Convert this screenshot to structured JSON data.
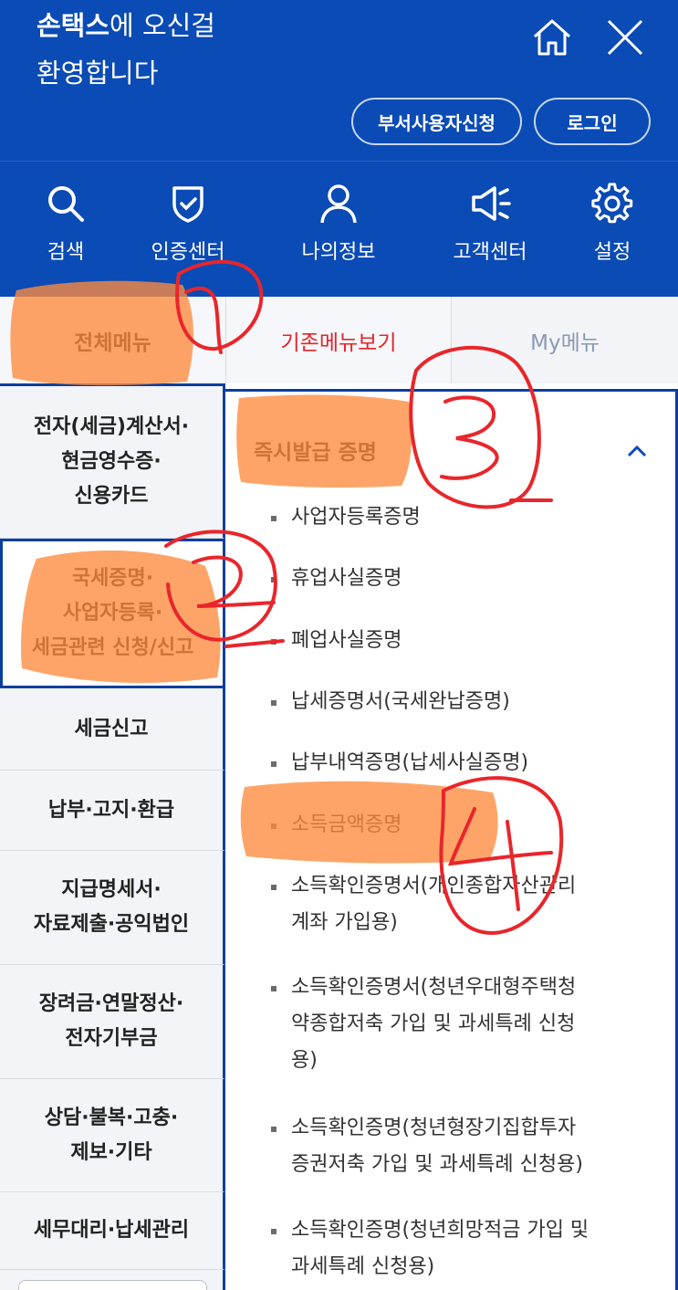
{
  "header": {
    "brand": "손택스",
    "welcome_rest": "에 오신걸",
    "welcome_line2": "환영합니다",
    "dept_user_button": "부서사용자신청",
    "login_button": "로그인"
  },
  "nav": [
    {
      "label": "검색",
      "icon": "search-icon"
    },
    {
      "label": "인증센터",
      "icon": "shield-check-icon"
    },
    {
      "label": "나의정보",
      "icon": "user-icon"
    },
    {
      "label": "고객센터",
      "icon": "megaphone-icon"
    },
    {
      "label": "설정",
      "icon": "gear-icon"
    }
  ],
  "tabs": {
    "all_menu": "전체메뉴",
    "old_menu": "기존메뉴보기",
    "my_menu": "My메뉴"
  },
  "categories": [
    {
      "lines": [
        "전자(세금)계산서·",
        "현금영수증·",
        "신용카드"
      ]
    },
    {
      "lines": [
        "국세증명·",
        "사업자등록·",
        "세금관련 신청/신고"
      ]
    },
    {
      "lines": [
        "세금신고"
      ]
    },
    {
      "lines": [
        "납부·고지·환급"
      ]
    },
    {
      "lines": [
        "지급명세서·",
        "자료제출·공익법인"
      ]
    },
    {
      "lines": [
        "장려금·연말정산·",
        "전자기부금"
      ]
    },
    {
      "lines": [
        "상담·불복·고충·",
        "제보·기타"
      ]
    },
    {
      "lines": [
        "세무대리·납세관리"
      ]
    }
  ],
  "section": {
    "title": "즉시발급 증명",
    "items": [
      {
        "lines": [
          "사업자등록증명"
        ]
      },
      {
        "lines": [
          "휴업사실증명"
        ]
      },
      {
        "lines": [
          "폐업사실증명"
        ]
      },
      {
        "lines": [
          "납세증명서(국세완납증명)"
        ]
      },
      {
        "lines": [
          "납부내역증명(납세사실증명)"
        ]
      },
      {
        "lines": [
          "소득금액증명"
        ]
      },
      {
        "lines": [
          "소득확인증명서(개인종합자산관리",
          "계좌 가입용)"
        ]
      },
      {
        "lines": [
          "소득확인증명서(청년우대형주택청",
          "약종합저축 가입 및 과세특례 신청",
          "용)"
        ]
      },
      {
        "lines": [
          "소득확인증명(청년형장기집합투자",
          "증권저축 가입 및 과세특례 신청용)"
        ]
      },
      {
        "lines": [
          "소득확인증명(청년희망적금 가입 및",
          "과세특례 신청용)"
        ]
      }
    ]
  },
  "annotations": [
    "1",
    "2",
    "3",
    "4"
  ],
  "colors": {
    "header_blue": "#0a4bb5",
    "selected_border": "#0a3fa0",
    "old_menu_red": "#e3242b",
    "highlight_orange": "#ff8a3d",
    "annotation_red": "#e8262b"
  }
}
